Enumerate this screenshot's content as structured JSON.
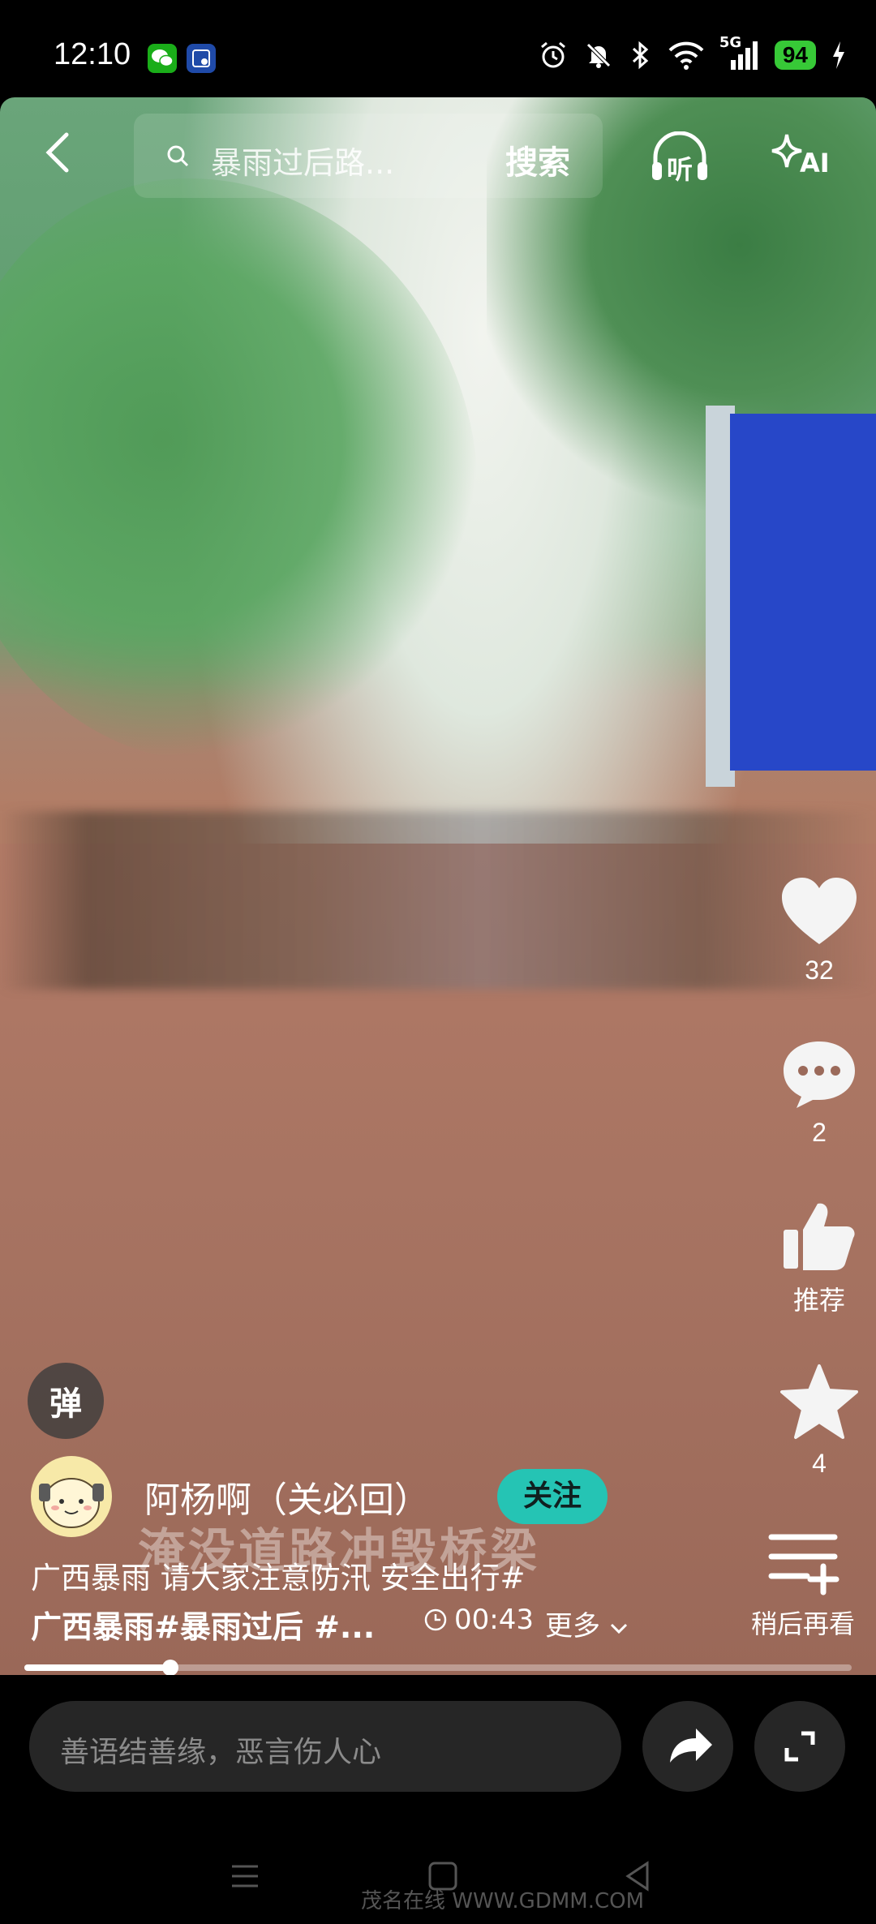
{
  "status_bar": {
    "time": "12:10",
    "battery": "94",
    "network": "5G"
  },
  "top_bar": {
    "search_placeholder": "暴雨过后路...",
    "search_button": "搜索",
    "listen_label": "听",
    "ai_label": "AI"
  },
  "video": {
    "overlay_caption": "淹没道路冲毁桥梁"
  },
  "side_actions": {
    "likes": "32",
    "comments": "2",
    "recommend": "推荐",
    "favorites": "4",
    "watch_later": "稍后再看"
  },
  "danmu": {
    "label": "弹"
  },
  "author": {
    "name": "阿杨啊（关必回）",
    "follow": "关注"
  },
  "description": {
    "line1": "广西暴雨 请大家注意防汛 安全出行#",
    "line2": "广西暴雨#暴雨过后 #...",
    "duration": "00:43",
    "more": "更多"
  },
  "progress": {
    "fraction": 0.176
  },
  "bottom": {
    "comment_placeholder": "善语结善缘，恶言伤人心"
  },
  "watermark": "茂名在线 WWW.GDMM.COM"
}
